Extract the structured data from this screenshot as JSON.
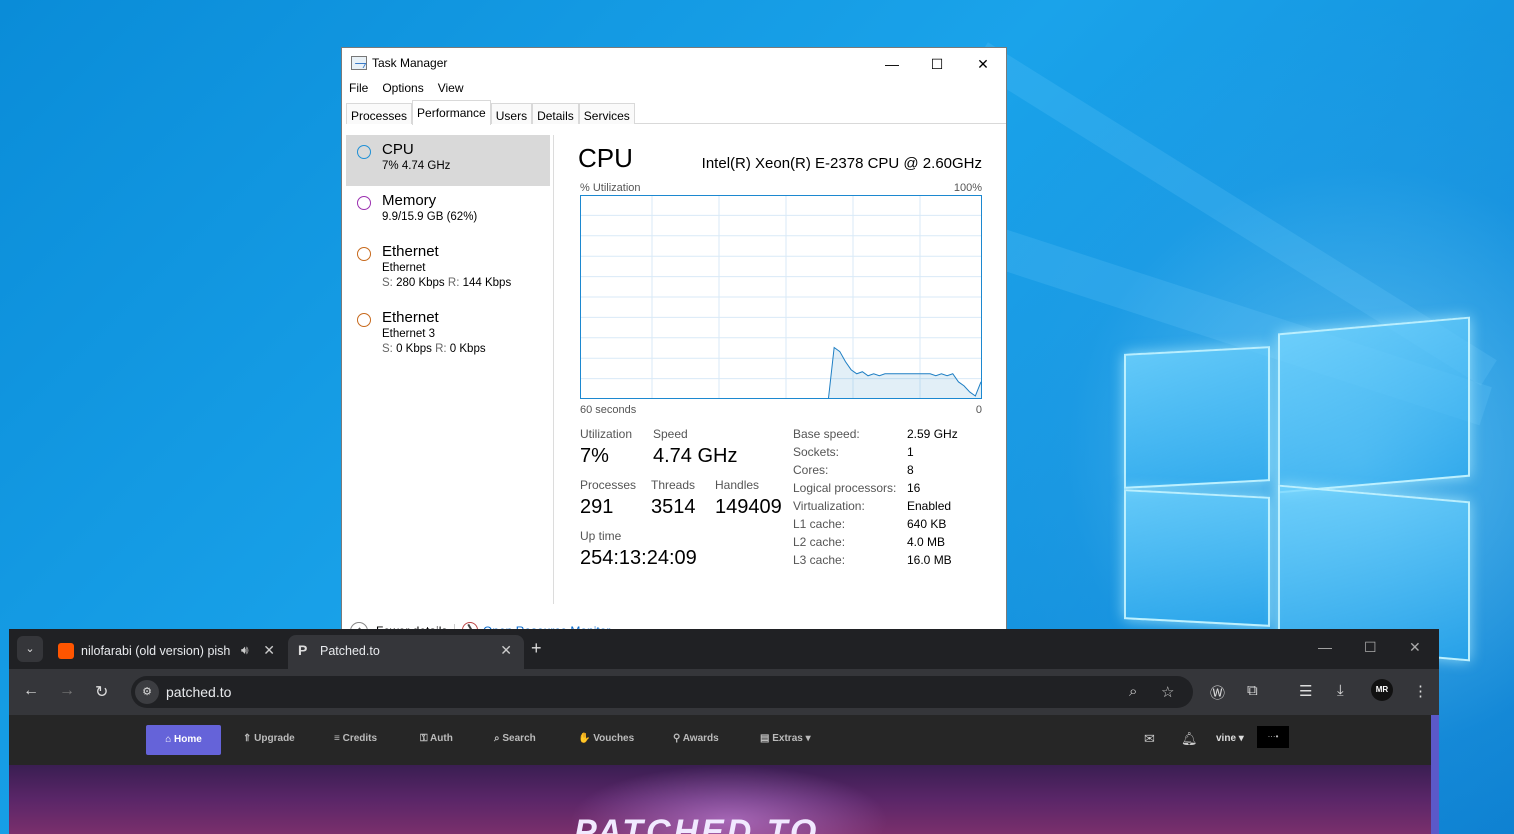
{
  "task_manager": {
    "title": "Task Manager",
    "menu": [
      "File",
      "Options",
      "View"
    ],
    "tabs": [
      "Processes",
      "Performance",
      "Users",
      "Details",
      "Services"
    ],
    "sidebar": [
      {
        "title": "CPU",
        "line1": "7% 4.74 GHz",
        "color": "#1f90d6"
      },
      {
        "title": "Memory",
        "line1": "9.9/15.9 GB (62%)",
        "color": "#9b2fb0"
      },
      {
        "title": "Ethernet",
        "line1": "Ethernet",
        "s_label": "S:",
        "s_val": "280 Kbps",
        "r_label": "R:",
        "r_val": "144 Kbps",
        "color": "#c7691c"
      },
      {
        "title": "Ethernet",
        "line1": "Ethernet 3",
        "s_label": "S:",
        "s_val": "0 Kbps",
        "r_label": "R:",
        "r_val": "0 Kbps",
        "color": "#c7691c"
      }
    ],
    "cpu": {
      "heading": "CPU",
      "model": "Intel(R) Xeon(R) E-2378 CPU @ 2.60GHz",
      "util_label": "% Utilization",
      "util_max": "100%",
      "time_label": "60 seconds",
      "time_end": "0",
      "stats": {
        "utilization_label": "Utilization",
        "utilization": "7%",
        "speed_label": "Speed",
        "speed": "4.74 GHz",
        "processes_label": "Processes",
        "processes": "291",
        "threads_label": "Threads",
        "threads": "3514",
        "handles_label": "Handles",
        "handles": "149409",
        "uptime_label": "Up time",
        "uptime": "254:13:24:09"
      },
      "specs": [
        {
          "label": "Base speed:",
          "value": "2.59 GHz"
        },
        {
          "label": "Sockets:",
          "value": "1"
        },
        {
          "label": "Cores:",
          "value": "8"
        },
        {
          "label": "Logical processors:",
          "value": "16"
        },
        {
          "label": "Virtualization:",
          "value": "Enabled"
        },
        {
          "label": "L1 cache:",
          "value": "640 KB"
        },
        {
          "label": "L2 cache:",
          "value": "4.0 MB"
        },
        {
          "label": "L3 cache:",
          "value": "16.0 MB"
        }
      ],
      "history": [
        0,
        0,
        0,
        0,
        0,
        0,
        0,
        0,
        0,
        0,
        0,
        0,
        0,
        0,
        0,
        0,
        0,
        0,
        0,
        0,
        0,
        0,
        0,
        0,
        0,
        0,
        0,
        0,
        0,
        0,
        0,
        0,
        0,
        0,
        0,
        0,
        0,
        0,
        0,
        0,
        0,
        0,
        0,
        0,
        0,
        25,
        23,
        18,
        14,
        12,
        13,
        11,
        12,
        11,
        12,
        12,
        12,
        12,
        12,
        12,
        12,
        12,
        12,
        11,
        12,
        11,
        12,
        8,
        6,
        3,
        1,
        8
      ]
    },
    "footer": {
      "fewer": "Fewer details",
      "monitor": "Open Resource Monitor"
    }
  },
  "browser": {
    "tabs": [
      {
        "title": "nilofarabi (old version) pish",
        "favicon_color": "#ff5500"
      },
      {
        "title": "Patched.to"
      }
    ],
    "url": "patched.to",
    "avatar_text": "MR"
  },
  "site": {
    "nav": [
      "Home",
      "Upgrade",
      "Credits",
      "Auth",
      "Search",
      "Vouches",
      "Awards",
      "Extras"
    ],
    "nav_icons": [
      "⌂",
      "⇑",
      "≡",
      "⚿",
      "⌕",
      "✋",
      "⚲",
      "▤"
    ],
    "user": "vine",
    "badge": "···•",
    "hero_text": "PATCHED.TO"
  }
}
